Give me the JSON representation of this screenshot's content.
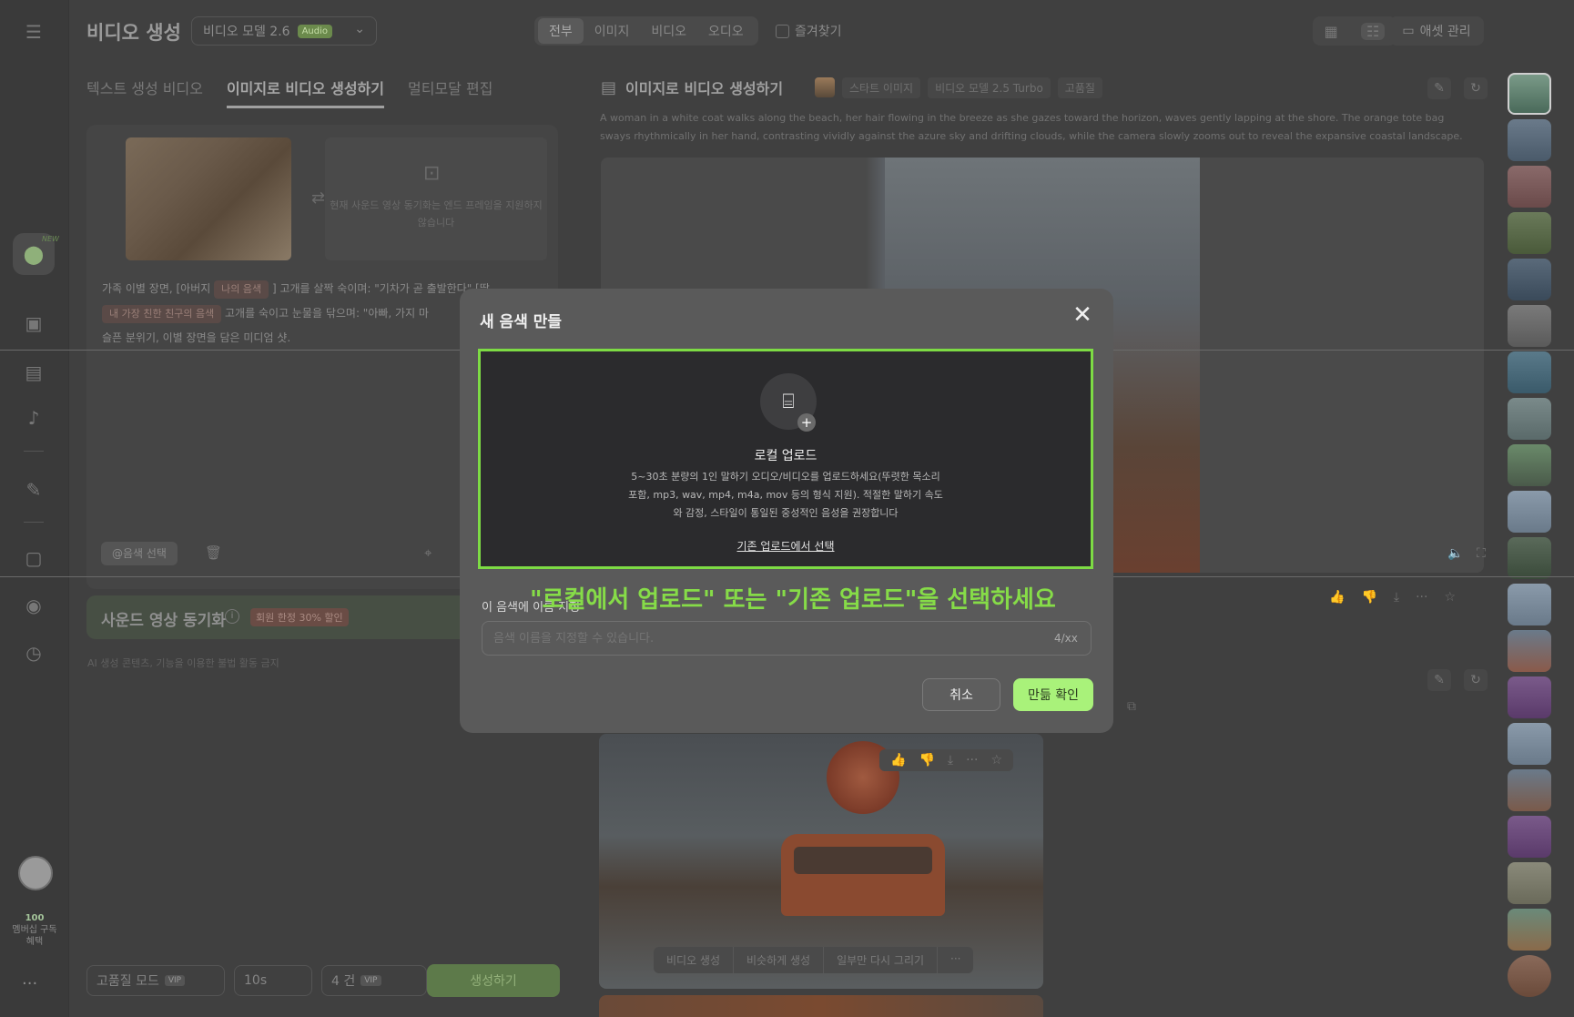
{
  "app": {
    "title": "비디오 생성",
    "model_label": "비디오 모델 2.6",
    "model_badge": "Audio"
  },
  "filters": {
    "tabs": [
      "전부",
      "이미지",
      "비디오",
      "오디오"
    ],
    "favorites": "즐겨찾기"
  },
  "toolbar": {
    "asset_manager": "애셋 관리"
  },
  "sidebar": {
    "new_tag": "NEW",
    "credits": "100",
    "membership": "멤버십 구독 혜택"
  },
  "left_panel": {
    "mode_tabs": [
      "텍스트 생성 비디오",
      "이미지로 비디오 생성하기",
      "멀티모달 편집"
    ],
    "end_frame_hint": "현재 사운드 영상 동기화는 엔드 프레임을 지원하지 않습니다",
    "prompt_part1": "가족 이별 장면, [아버지",
    "chip_my_voice": "나의 음색",
    "prompt_part2": "] 고개를 살짝 숙이며: \"기차가 곧 출발한다\" [딸",
    "chip_friend_voice": "내 가장 친한 친구의 음색",
    "prompt_part3": "고개를 숙이고 눈물을 닦으며: \"아빠, 가지 마",
    "prompt_part4": "슬픈 분위기, 이별 장면을 담은 미디엄 샷.",
    "voice_select": "@음색 선택",
    "sync_title": "사운드 영상 동기화",
    "sync_badge": "회원 한정 30% 할인",
    "notice": "AI 생성 콘텐츠, 기능을 이용한 불법 활동 금지",
    "quality_mode": "고품질 모드",
    "vip": "VIP",
    "duration": "10s",
    "count": "4 건",
    "generate": "생성하기"
  },
  "task": {
    "title": "이미지로 비디오 생성하기",
    "tags": [
      "스타트 이미지",
      "비디오 모델 2.5 Turbo",
      "고품질"
    ],
    "description": "A woman in a white coat walks along the beach, her hair flowing in the breeze as she gazes toward the horizon, waves gently lapping at the shore. The orange tote bag sways rhythmically in her hand, contrasting vividly against the azure sky and drifting clouds, while the camera slowly zooms out to reveal the expansive coastal landscape.",
    "card_actions": [
      "비디오 생성",
      "비슷하게 생성",
      "일부만 다시 그리기",
      "···"
    ]
  },
  "modal": {
    "title": "새 음색 만들",
    "upload_title": "로컬 업로드",
    "upload_desc": "5~30초 분량의 1인 말하기 오디오/비디오를 업로드하세요(뚜렷한 목소리 포함, mp3, wav, mp4, m4a,  mov 등의 형식 지원). 적절한 말하기 속도와 감정, 스타일이 통일된 중성적인 음성을 권장합니다",
    "upload_link": "기존 업로드에서 선택",
    "name_label": "이 음색에 이름 지정",
    "name_placeholder": "음색 이름을 지정할 수 있습니다.",
    "name_counter": "4/xx",
    "cancel": "취소",
    "confirm": "만듦 확인"
  },
  "callout": "\"로컬에서 업로드\" 또는 \"기존 업로드\"을 선택하세요",
  "colors": {
    "accent": "#a9f27a",
    "highlight_border": "#7ddb44",
    "callout": "#86dc48"
  }
}
